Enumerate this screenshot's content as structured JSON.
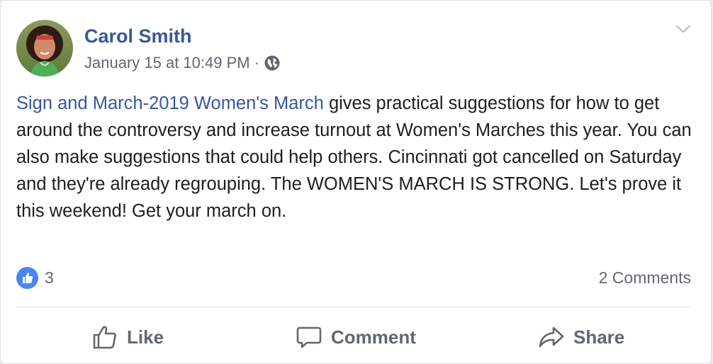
{
  "post": {
    "author": "Carol Smith",
    "timestamp": "January 15 at 10:49 PM",
    "separator": "·",
    "privacy_icon": "globe-icon",
    "menu_icon": "chevron-down-icon",
    "body": {
      "link_text": "Sign and March-2019 Women's March",
      "text": " gives practical suggestions for how to get around the controversy and increase turnout at Women's Marches this year. You can also make suggestions that could help others. Cincinnati got cancelled on Saturday and they're already regrouping. The WOMEN'S MARCH IS STRONG. Let's prove it this weekend! Get your march on."
    }
  },
  "stats": {
    "reaction_icon": "thumbs-up-icon",
    "like_count": "3",
    "comments": "2 Comments"
  },
  "actions": {
    "like": "Like",
    "comment": "Comment",
    "share": "Share"
  },
  "colors": {
    "author_link": "#385898",
    "meta_text": "#606770",
    "body_text": "#1c1e21",
    "like_badge": "#4a84f5",
    "divider": "#dadde1"
  }
}
